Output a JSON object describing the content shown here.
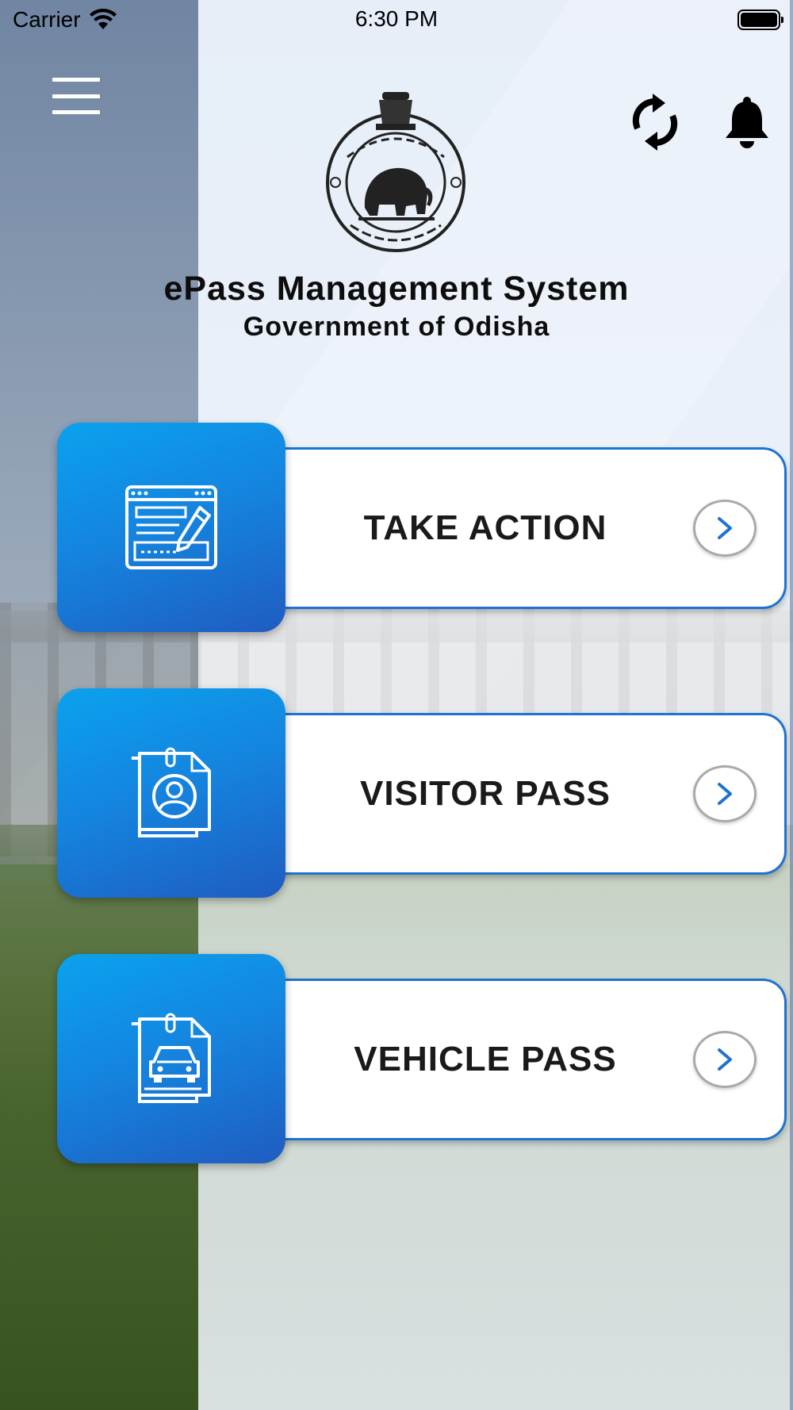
{
  "status_bar": {
    "carrier": "Carrier",
    "time": "6:30 PM",
    "wifi_icon": "wifi-icon",
    "battery_icon": "battery-icon"
  },
  "header": {
    "menu_icon": "hamburger-menu-icon",
    "emblem": "government-of-odisha-emblem",
    "refresh_icon": "refresh-icon",
    "notifications_icon": "bell-icon",
    "title": "ePass Management System",
    "subtitle": "Government of Odisha"
  },
  "actions": [
    {
      "label": "TAKE ACTION",
      "icon": "form-edit-icon"
    },
    {
      "label": "VISITOR PASS",
      "icon": "visitor-id-card-icon"
    },
    {
      "label": "VEHICLE PASS",
      "icon": "vehicle-document-icon"
    }
  ],
  "colors": {
    "accent_blue": "#1486e0",
    "accent_blue_light": "#0aa2ee",
    "accent_blue_dark": "#1f5cc0",
    "card_border": "#1e73d2",
    "text_dark": "#1a1a1a"
  }
}
